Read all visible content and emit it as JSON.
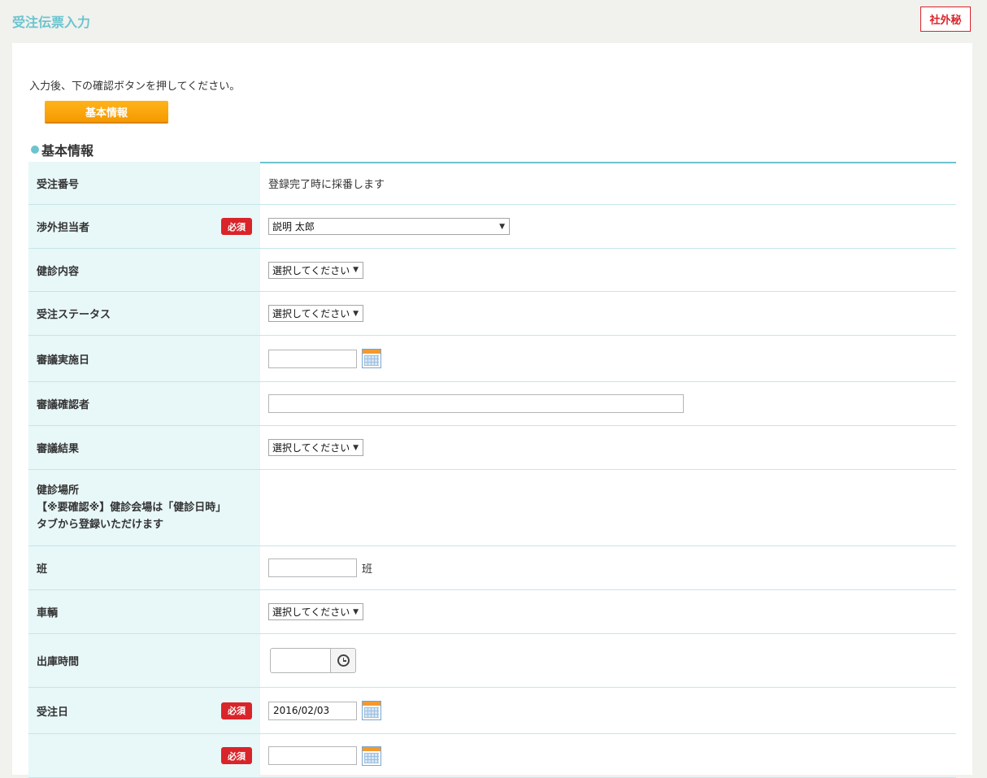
{
  "header": {
    "title": "受注伝票入力",
    "confidential_label": "社外秘"
  },
  "instruction": "入力後、下の確認ボタンを押してください。",
  "tab": {
    "label": "基本情報"
  },
  "section": {
    "title": "基本情報"
  },
  "required_label": "必須",
  "fields": {
    "order_number": {
      "label": "受注番号",
      "value": "登録完了時に採番します"
    },
    "sales_rep": {
      "label": "渉外担当者",
      "value": "説明 太郎"
    },
    "checkup_content": {
      "label": "健診内容",
      "value": "選択してください"
    },
    "order_status": {
      "label": "受注ステータス",
      "value": "選択してください"
    },
    "review_date": {
      "label": "審議実施日",
      "value": ""
    },
    "review_confirmer": {
      "label": "審議確認者",
      "value": ""
    },
    "review_result": {
      "label": "審議結果",
      "value": "選択してください"
    },
    "checkup_location": {
      "label_line1": "健診場所",
      "label_line2": "【※要確認※】健診会場は「健診日時」",
      "label_line3": "タブから登録いただけます"
    },
    "team": {
      "label": "班",
      "value": "",
      "unit": "班"
    },
    "vehicle": {
      "label": "車輌",
      "value": "選択してください"
    },
    "departure_time": {
      "label": "出庫時間",
      "value": ""
    },
    "order_date": {
      "label": "受注日",
      "value": "2016/02/03"
    }
  },
  "icons": {
    "calendar": "calendar-icon",
    "clock": "clock-icon",
    "bullet": "circle-bullet"
  },
  "colors": {
    "accent": "#6cc4cf",
    "required": "#d9242a",
    "tab": "#f59a00",
    "label_bg": "#e8f7f8"
  }
}
